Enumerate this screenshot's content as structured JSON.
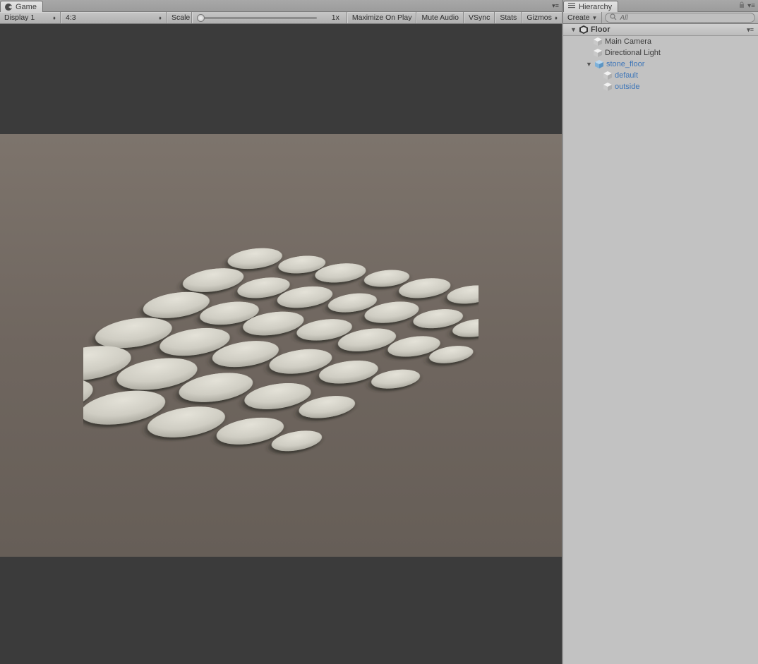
{
  "game_tab": {
    "label": "Game"
  },
  "toolbar": {
    "display_label": "Display 1",
    "aspect_label": "4:3",
    "scale_label": "Scale",
    "scale_value": "1x",
    "maximize_label": "Maximize On Play",
    "mute_label": "Mute Audio",
    "vsync_label": "VSync",
    "stats_label": "Stats",
    "gizmos_label": "Gizmos"
  },
  "hierarchy_tab": {
    "label": "Hierarchy"
  },
  "hierarchy_toolbar": {
    "create_label": "Create",
    "search_placeholder": "All"
  },
  "hierarchy_tree": {
    "scene_name": "Floor",
    "items": [
      {
        "name": "Main Camera",
        "prefab": false
      },
      {
        "name": "Directional Light",
        "prefab": false
      },
      {
        "name": "stone_floor",
        "prefab": true,
        "expanded": true,
        "children": [
          {
            "name": "default",
            "prefab": true
          },
          {
            "name": "outside",
            "prefab": true
          }
        ]
      }
    ]
  }
}
